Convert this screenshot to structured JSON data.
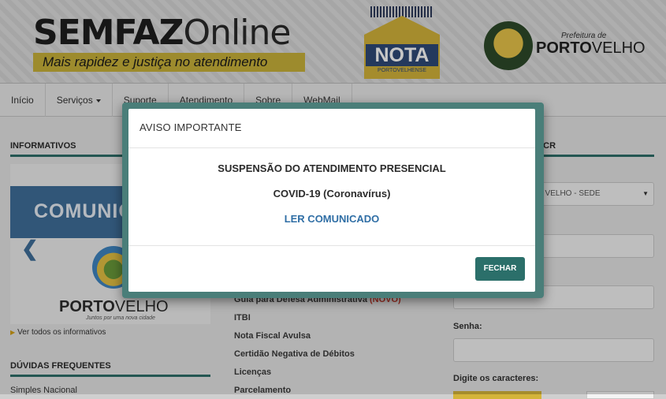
{
  "header": {
    "logo_bold": "SEMFAZ",
    "logo_light": "Online",
    "tagline": "Mais rapidez e justiça no atendimento",
    "nota_label": "NOTA",
    "nota_sub": "PORTOVELHENSE",
    "prefeitura_pre": "Prefeitura de",
    "prefeitura_bold": "PORTO",
    "prefeitura_light": "VELHO"
  },
  "nav": {
    "items": [
      {
        "label": "Início"
      },
      {
        "label": "Serviços"
      },
      {
        "label": "Suporte"
      },
      {
        "label": "Atendimento"
      },
      {
        "label": "Sobre"
      },
      {
        "label": "WebMail"
      }
    ]
  },
  "left": {
    "informativos_title": "INFORMATIVOS",
    "banner_text": "COMUNIC",
    "banner_arrow": "❮",
    "banner_pv_bold": "PORTO",
    "banner_pv_light": "VELHO",
    "banner_slogan": "Juntos por uma nova cidade",
    "ver_todos": "Ver todos os informativos",
    "duvidas_title": "DÚVIDAS FREQUENTES",
    "faq_first": "Simples Nacional"
  },
  "middle": {
    "links": [
      {
        "label": "Guia para Defesa Administrativa",
        "badge": "(NOVO)"
      },
      {
        "label": "ITBI"
      },
      {
        "label": "Nota Fiscal Avulsa"
      },
      {
        "label": "Certidão Negativa de Débitos"
      },
      {
        "label": "Licenças"
      },
      {
        "label": "Parcelamento"
      }
    ]
  },
  "right": {
    "section_title": "MCR",
    "select_value": "O VELHO - SEDE",
    "senha_label": "Senha:",
    "captcha_label": "Digite os caracteres:"
  },
  "modal": {
    "title": "AVISO IMPORTANTE",
    "line1": "SUSPENSÃO DO ATENDIMENTO PRESENCIAL",
    "line2": "COVID-19 (Coronavírus)",
    "link": "LER COMUNICADO",
    "close_button": "FECHAR"
  }
}
